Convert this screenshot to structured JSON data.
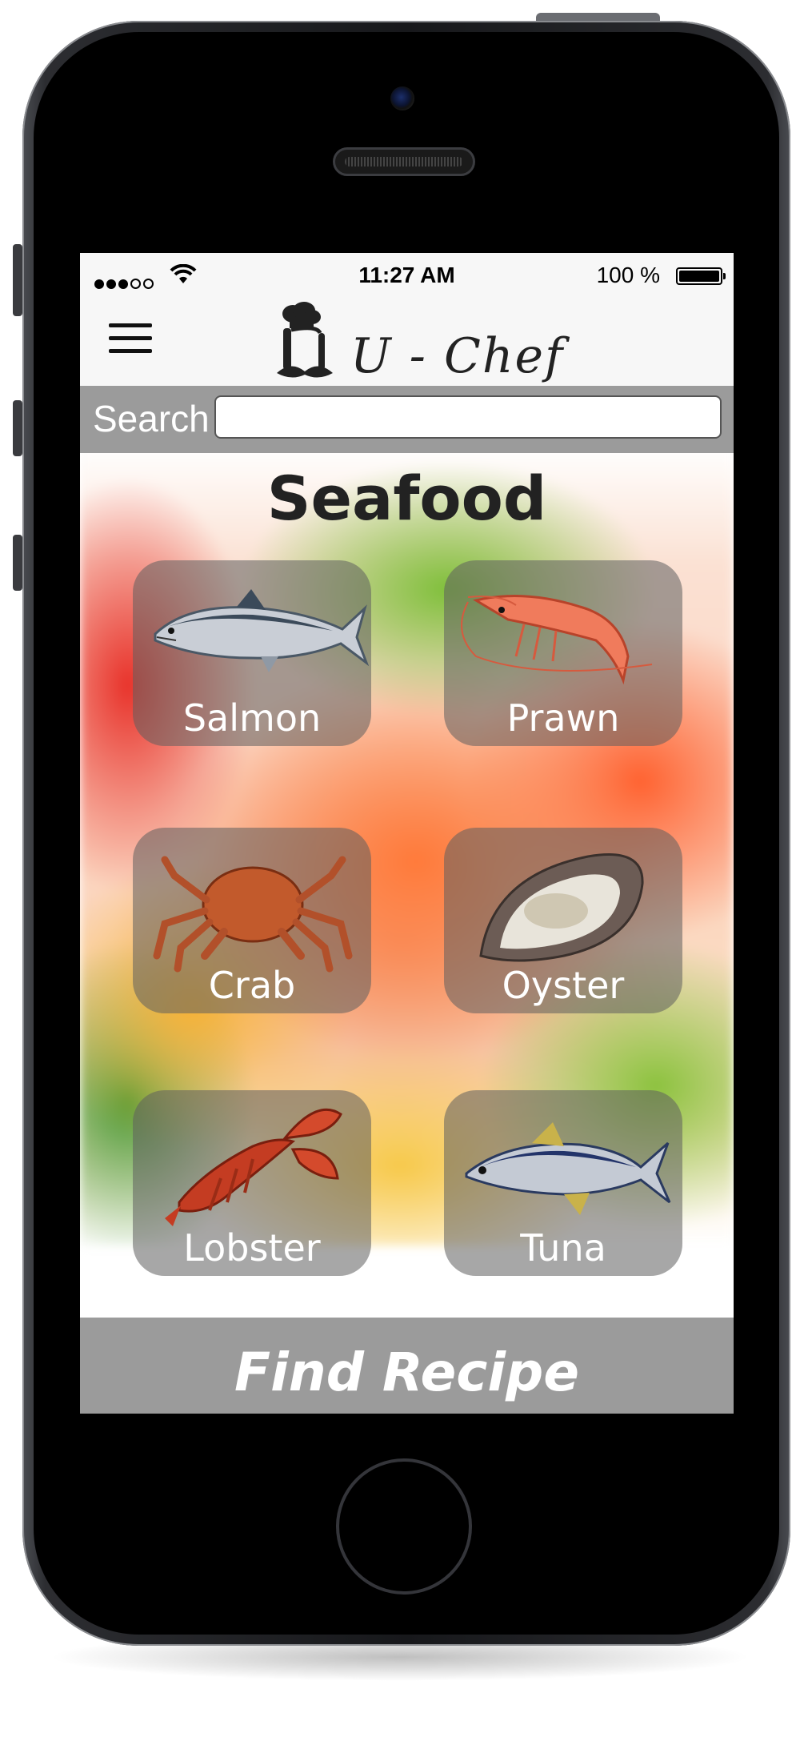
{
  "status_bar": {
    "time": "11:27 AM",
    "battery": "100 %",
    "signal_icon": "signal-dots-icon",
    "wifi_icon": "wifi-icon",
    "battery_icon": "battery-full-icon"
  },
  "header": {
    "title": "U - Chef",
    "menu_icon": "hamburger-menu-icon",
    "logo_icon": "chef-hat-mustache-icon"
  },
  "search": {
    "label": "Search",
    "value": "",
    "placeholder": ""
  },
  "category": {
    "title": "Seafood"
  },
  "items": [
    {
      "label": "Salmon",
      "icon": "salmon-icon"
    },
    {
      "label": "Prawn",
      "icon": "prawn-icon"
    },
    {
      "label": "Crab",
      "icon": "crab-icon"
    },
    {
      "label": "Oyster",
      "icon": "oyster-icon"
    },
    {
      "label": "Lobster",
      "icon": "lobster-icon"
    },
    {
      "label": "Tuna",
      "icon": "tuna-icon"
    }
  ],
  "actions": {
    "find_recipe": "Find Recipe"
  },
  "colors": {
    "bar_gray": "#9b9b9b",
    "tile_overlay": "rgba(95,95,95,0.55)",
    "phone_body": "#1c1d20"
  }
}
